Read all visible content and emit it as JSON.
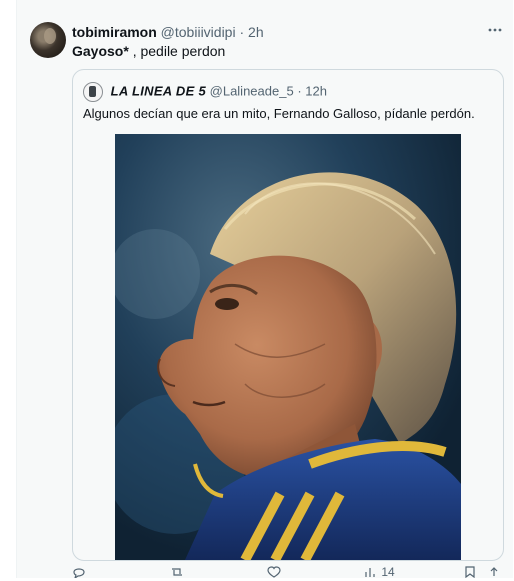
{
  "tweet": {
    "display_name": "tobimiramon",
    "handle": "@tobiiividipi",
    "separator": "·",
    "time": "2h",
    "text_bold": "Gayoso*",
    "text_rest": " , pedile perdon",
    "more_icon": "more-horizontal-icon"
  },
  "quote": {
    "display_name": "LA LINEA DE 5",
    "handle": "@Lalineade_5",
    "separator": "·",
    "time": "12h",
    "text": "Algunos decían que era un mito, Fernando Galloso, pídanle perdón."
  },
  "actions": {
    "reply_icon": "reply-icon",
    "retweet_icon": "retweet-icon",
    "like_icon": "heart-icon",
    "views_icon": "views-icon",
    "views_count": "14",
    "bookmark_icon": "bookmark-icon",
    "share_icon": "share-icon"
  },
  "colors": {
    "text_primary": "#0f1419",
    "text_secondary": "#536471",
    "border": "#cfd9de",
    "background": "#f7f9f9",
    "jacket_stripe": "#e0b83a",
    "jacket_blue": "#1f3f86"
  }
}
